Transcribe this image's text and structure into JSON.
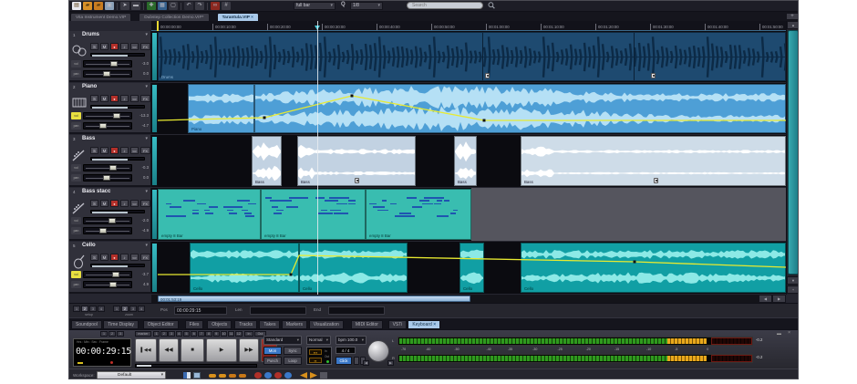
{
  "toolbar": {
    "icons": [
      "new-file-icon",
      "open-folder-icon",
      "open-project-icon",
      "save-icon",
      "pointer-tool-icon",
      "range-tool-icon",
      "arranger-icon",
      "mixer-icon",
      "monitor-icon",
      "undo-icon",
      "redo-icon",
      "loop-icon",
      "grid-icon"
    ],
    "full_bar_label": "full bar",
    "q_label": "Q",
    "quantize_label": "1/8",
    "search_placeholder": "Search",
    "add_tab_label": "+"
  },
  "tabs": [
    {
      "label": "Vita Instrument Demo.VIP",
      "active": false
    },
    {
      "label": "Dubstep Collection Demo.VIP*",
      "active": false
    },
    {
      "label": "Tarantula.VIP",
      "active": true,
      "close": "×"
    }
  ],
  "ruler": {
    "labels": [
      "00:00:00:00",
      "00:00:10:00",
      "00:00:20:00",
      "00:00:30:00",
      "00:00:40:00",
      "00:00:50:00",
      "00:01:00:00",
      "00:01:10:00",
      "00:01:20:00",
      "00:01:30:00",
      "00:01:40:00",
      "00:01:50:00"
    ]
  },
  "tracks": [
    {
      "num": "1",
      "name": "Drums",
      "instrument": "drums-icon",
      "solo": "S",
      "mute": "M",
      "rec": "●",
      "monitor": "♪",
      "auto": "▭",
      "fx": "FX",
      "vol_label": "vol",
      "pan_label": "pan",
      "vol": "-3.0",
      "pan": "0.0",
      "vol_auto": false
    },
    {
      "num": "2",
      "name": "Piano",
      "instrument": "piano-icon",
      "solo": "S",
      "mute": "M",
      "rec": "●",
      "monitor": "♪",
      "auto": "▭",
      "fx": "FX",
      "vol_label": "vol",
      "pan_label": "pan",
      "vol": "-13.3",
      "pan": "-4.7",
      "vol_auto": true
    },
    {
      "num": "3",
      "name": "Bass",
      "instrument": "bass-icon",
      "solo": "S",
      "mute": "M",
      "rec": "●",
      "monitor": "♪",
      "auto": "▭",
      "fx": "FX",
      "vol_label": "vol",
      "pan_label": "pan",
      "vol": "-0.3",
      "pan": "0.0",
      "vol_auto": false
    },
    {
      "num": "4",
      "name": "Bass stacc",
      "instrument": "bass-icon",
      "solo": "S",
      "mute": "M",
      "rec": "●",
      "monitor": "♪",
      "auto": "▭",
      "fx": "FX",
      "vol_label": "vol",
      "pan_label": "pan",
      "vol": "-2.0",
      "pan": "-4.9",
      "vol_auto": false
    },
    {
      "num": "5",
      "name": "Cello",
      "instrument": "cello-icon",
      "solo": "S",
      "mute": "M",
      "rec": "●",
      "monitor": "♪",
      "auto": "▭",
      "fx": "FX",
      "vol_label": "vol",
      "pan_label": "pan",
      "vol": "-3.7",
      "pan": "4.9",
      "vol_auto": true
    }
  ],
  "clips": {
    "drums": "Drums",
    "piano": "Piano",
    "bass": "Bass",
    "midi": "empty 8 Bar",
    "cello": "Cello"
  },
  "scroll": {
    "h_label": "00:01:53:19"
  },
  "posbar": {
    "pos_label": "Pos",
    "pos_value": "00:00:29:15",
    "len_label": "Len",
    "end_label": "End",
    "setup_caption": "setup",
    "zoom_caption": "zoom",
    "setup_buttons": [
      "1",
      "2",
      "3",
      "4"
    ],
    "zoom_buttons": [
      "1",
      "2",
      "3",
      "4"
    ]
  },
  "bottom_tabs": [
    "Soundpool",
    "Time Display",
    "Object Editor",
    "Files",
    "Objects",
    "Tracks",
    "Takes",
    "Markers",
    "Visualization",
    "MIDI Editor",
    "VSTi"
  ],
  "bottom_tab_active": {
    "label": "Keyboard",
    "close": "×"
  },
  "transport": {
    "preset_buttons": [
      "1",
      "2",
      "3"
    ],
    "marker_label": "marker",
    "markers": [
      "1",
      "2",
      "3",
      "4",
      "5",
      "6",
      "7",
      "8",
      "9",
      "10",
      "11",
      "12"
    ],
    "in_label": "In",
    "out_label": "Out",
    "lcd_caption": "Hrs : Min : Sec : Frame",
    "lcd_value": "00:00:29:15",
    "buttons": [
      "skip-start",
      "rewind",
      "stop",
      "play",
      "forward",
      "record"
    ],
    "mode_dropdown": "Standard",
    "mon": "Mon",
    "sync": "Sync",
    "punch": "Punch",
    "loop": "Loop",
    "tempo_mode": "Normal",
    "bpm_label": "bpm 100.0",
    "timesig": "4 / 4",
    "click": "Click",
    "channel_l": "L",
    "channel_r": "R",
    "meter_scale": [
      "-70",
      "-60",
      "-50",
      "-40",
      "-35",
      "-30",
      "-25",
      "-20",
      "-15",
      "-10",
      "-5",
      "0"
    ],
    "peak_l": "-0.2",
    "peak_r": "-0.2"
  },
  "statusbar": {
    "workspace_label": "Workspace:",
    "workspace_value": "Default",
    "icons": [
      "window-layout-icon",
      "docking-icon",
      "audio-cable-icon",
      "audio-cable-icon-2",
      "midi-cable-icon",
      "midi-cable-icon-2",
      "record-in-icon",
      "monitor-in-icon",
      "record-out-icon",
      "monitor-out-icon",
      "shift-left-icon",
      "shift-right-icon",
      "misc-icon"
    ]
  },
  "colors": {
    "accent_tab": "#a9c9e9",
    "drums_clip": "#1e4a70",
    "piano_clip": "#4e9fd6",
    "bass_clip": "#c2d2e2",
    "midi_clip": "#39bdb0",
    "cello_clip": "#119fa4",
    "automation": "#e8ea30",
    "meter_green": "#2f9a1e",
    "meter_orange": "#e8a81c",
    "record_red": "#b3302a"
  }
}
